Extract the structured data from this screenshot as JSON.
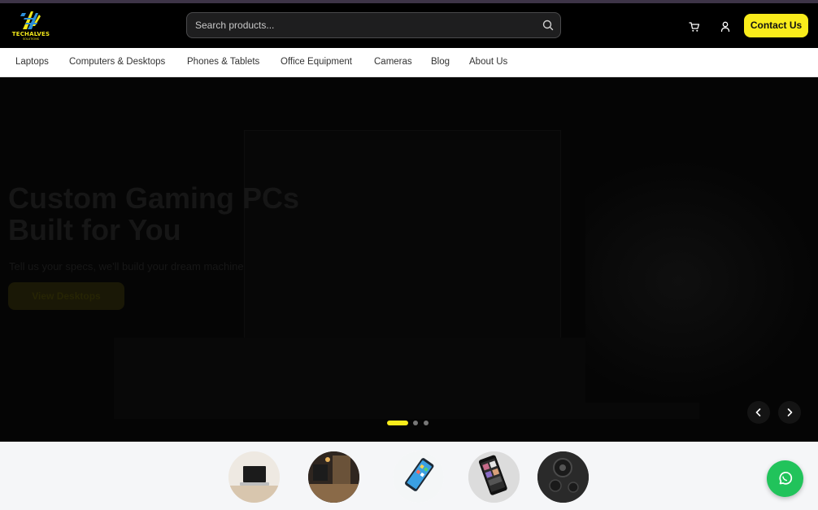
{
  "brand": {
    "name": "TECHALVES",
    "tagline": "SOLUTIONS"
  },
  "search": {
    "placeholder": "Search products..."
  },
  "header": {
    "contact_label": "Contact Us"
  },
  "nav": {
    "items": [
      {
        "label": "Laptops"
      },
      {
        "label": "Computers & Desktops"
      },
      {
        "label": "Phones & Tablets"
      },
      {
        "label": "Office Equipment"
      },
      {
        "label": "Cameras"
      },
      {
        "label": "Blog"
      },
      {
        "label": "About Us"
      }
    ]
  },
  "hero": {
    "title_line1": "Custom Gaming PCs",
    "title_line2": "Built for You",
    "subtitle": "Tell us your specs, we'll build your dream machine",
    "cta_label": "View Desktops",
    "active_slide": 1,
    "slide_count": 3
  },
  "colors": {
    "accent": "#f9ec1b",
    "whatsapp": "#21c35b",
    "header_bg": "#000000"
  },
  "categories": [
    {
      "icon": "laptop-category-image"
    },
    {
      "icon": "desktop-category-image"
    },
    {
      "icon": "phone-category-image"
    },
    {
      "icon": "tablet-category-image"
    },
    {
      "icon": "camera-category-image"
    }
  ]
}
